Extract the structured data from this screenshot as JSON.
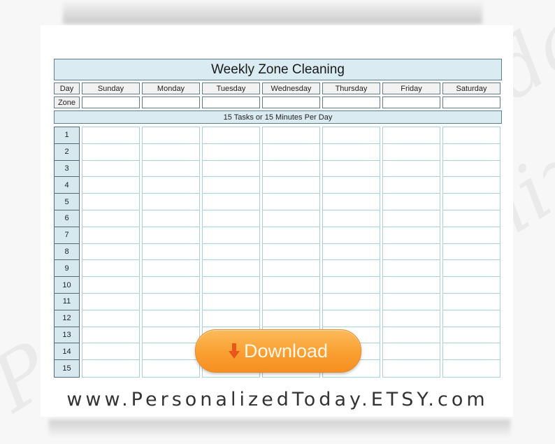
{
  "watermark": {
    "text": "PersonalizedToday"
  },
  "sheet": {
    "title": "Weekly Zone Cleaning",
    "day_label": "Day",
    "zone_label": "Zone",
    "days": [
      "Sunday",
      "Monday",
      "Tuesday",
      "Wednesday",
      "Thursday",
      "Friday",
      "Saturday"
    ],
    "subtitle": "15 Tasks or 15 Minutes Per Day",
    "task_numbers": [
      "1",
      "2",
      "3",
      "4",
      "5",
      "6",
      "7",
      "8",
      "9",
      "10",
      "11",
      "12",
      "13",
      "14",
      "15"
    ],
    "zones": [
      "",
      "",
      "",
      "",
      "",
      "",
      ""
    ]
  },
  "download_button": {
    "label": "Download",
    "icon": "arrow-down-icon",
    "color": "#f99d2e"
  },
  "footer": {
    "url": "www.PersonalizedToday.ETSY.com"
  },
  "colors": {
    "header_fill": "#daebf2",
    "border": "#5a7f8e",
    "grid_line": "#a9cfd9"
  }
}
